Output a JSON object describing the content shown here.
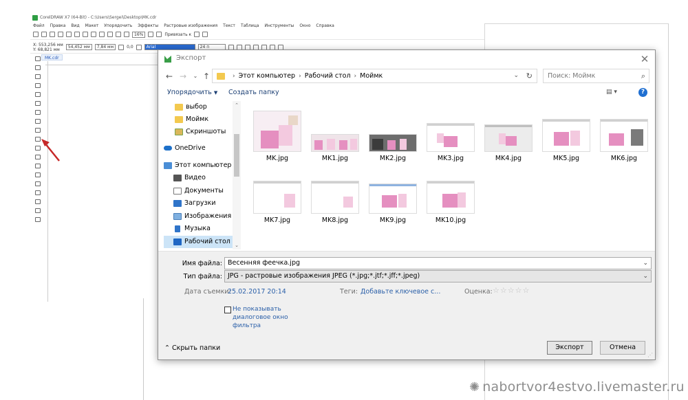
{
  "app": {
    "title": "CorelDRAW X7 (64-Bit) - C:\\Users\\Sergei\\Desktop\\MK.cdr",
    "menu": [
      "Файл",
      "Правка",
      "Вид",
      "Макет",
      "Упорядочить",
      "Эффекты",
      "Растровые изображения",
      "Текст",
      "Таблица",
      "Инструменты",
      "Окно",
      "Справка"
    ],
    "zoom": "16%",
    "snap_label": "Привязать к",
    "x_coord": "X: 553,256 мм",
    "y_coord": "Y: 68,821 мм",
    "width": "54,452 мм",
    "height": "7,84 мм",
    "angle": "0,0",
    "font_name": "Arial",
    "font_size": "24 п",
    "doc_tab": "MK.cdr"
  },
  "dialog": {
    "title": "Экспорт",
    "breadcrumb": [
      "Этот компьютер",
      "Рабочий стол",
      "Моймк"
    ],
    "search_placeholder": "Поиск: Моймк",
    "organize_label": "Упорядочить",
    "new_folder_label": "Создать папку",
    "nav_items": [
      {
        "label": "выбор",
        "icon": "folder-icon"
      },
      {
        "label": "Моймк",
        "icon": "folder-icon"
      },
      {
        "label": "Скриншоты",
        "icon": "screenshots-folder-icon"
      },
      {
        "label": "OneDrive",
        "icon": "onedrive-icon"
      },
      {
        "label": "Этот компьютер",
        "icon": "computer-icon"
      },
      {
        "label": "Видео",
        "icon": "video-icon"
      },
      {
        "label": "Документы",
        "icon": "documents-icon"
      },
      {
        "label": "Загрузки",
        "icon": "downloads-icon"
      },
      {
        "label": "Изображения",
        "icon": "pictures-icon"
      },
      {
        "label": "Музыка",
        "icon": "music-icon"
      },
      {
        "label": "Рабочий стол",
        "icon": "desktop-icon",
        "selected": true
      }
    ],
    "files": [
      {
        "name": "MK.jpg",
        "thumb": "photo-square"
      },
      {
        "name": "MK1.jpg",
        "thumb": "photo-strip"
      },
      {
        "name": "MK2.jpg",
        "thumb": "photo-strip-dark"
      },
      {
        "name": "MK3.jpg",
        "thumb": "screenshot"
      },
      {
        "name": "MK4.jpg",
        "thumb": "screenshot-grey"
      },
      {
        "name": "MK5.jpg",
        "thumb": "screenshot-tall"
      },
      {
        "name": "MK6.jpg",
        "thumb": "screenshot-tall"
      },
      {
        "name": "MK7.jpg",
        "thumb": "screenshot-tall"
      },
      {
        "name": "MK8.jpg",
        "thumb": "screenshot-tall"
      },
      {
        "name": "MK9.jpg",
        "thumb": "screenshot"
      },
      {
        "name": "MK10.jpg",
        "thumb": "screenshot-tall"
      }
    ],
    "filename_label": "Имя файла:",
    "filename_value": "Весенняя феечка.jpg",
    "filetype_label": "Тип файла:",
    "filetype_value": "JPG - растровые изображения JPEG (*.jpg;*.jtf;*.jff;*.jpeg)",
    "date_label": "Дата съемки:",
    "date_value": "25.02.2017 20:14",
    "tags_label": "Теги:",
    "tags_value": "Добавьте ключевое с...",
    "rating_label": "Оценка:",
    "rating_value": 0,
    "rating_max": 5,
    "filter_checkbox_label": "Не показывать диалоговое окно фильтра",
    "filter_checked": false,
    "collapse_label": "Скрыть папки",
    "export_button": "Экспорт",
    "cancel_button": "Отмена"
  },
  "watermark": "nabortvor4estvo.livemaster.ru",
  "colors": {
    "accent": "#2a5fa8",
    "selected_nav": "#cce4f7",
    "arrow": "#c62828",
    "folder": "#f3c94f"
  }
}
